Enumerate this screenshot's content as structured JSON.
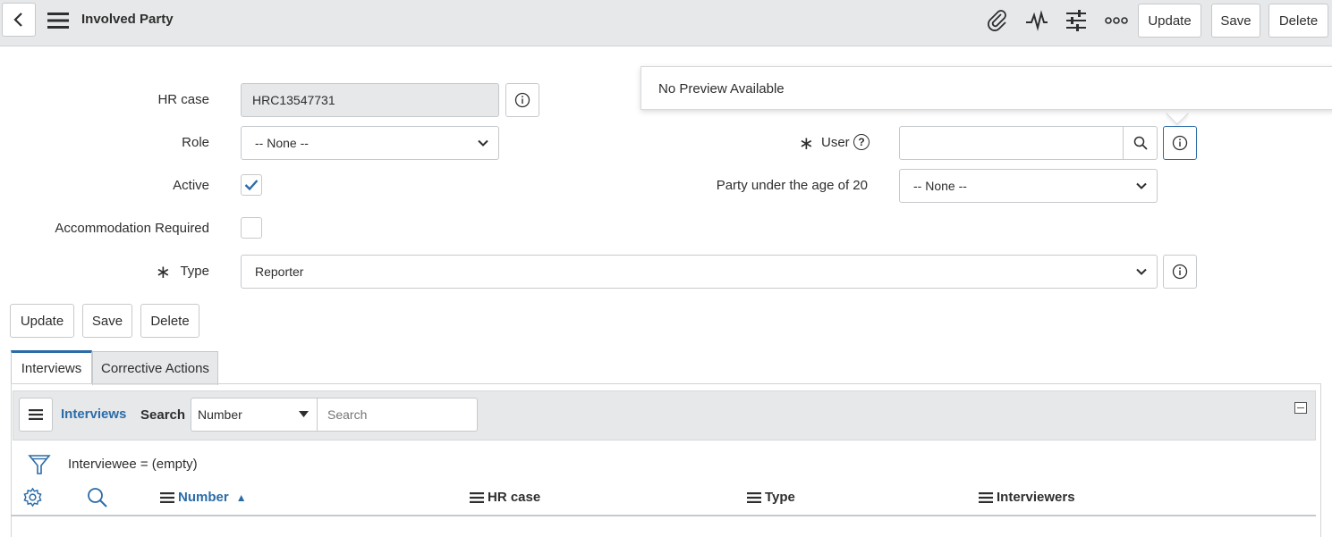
{
  "header": {
    "title": "Involved Party",
    "update_label": "Update",
    "save_label": "Save",
    "delete_label": "Delete"
  },
  "form": {
    "hr_case_label": "HR case",
    "hr_case_value": "HRC13547731",
    "role_label": "Role",
    "role_value": "-- None --",
    "active_label": "Active",
    "active_checked": true,
    "accommodation_label": "Accommodation Required",
    "accommodation_checked": false,
    "type_label": "Type",
    "type_value": "Reporter",
    "user_label": "User",
    "user_help": "?",
    "user_value": "",
    "party_age_label": "Party under the age of 20",
    "party_age_value": "-- None --",
    "required_marker": "∗"
  },
  "popover": {
    "text": "No Preview Available"
  },
  "actions": {
    "update_label": "Update",
    "save_label": "Save",
    "delete_label": "Delete"
  },
  "tabs": [
    {
      "label": "Interviews",
      "active": true
    },
    {
      "label": "Corrective Actions",
      "active": false
    }
  ],
  "list": {
    "title": "Interviews",
    "search_label": "Search",
    "search_field": "Number",
    "search_placeholder": "Search",
    "filter_text": "Interviewee = (empty)",
    "columns": [
      "Number",
      "HR case",
      "Type",
      "Interviewers"
    ],
    "sort_indicator": "▲"
  },
  "colors": {
    "accent": "#2b6ca8",
    "header_bg": "#e6e8ea"
  }
}
